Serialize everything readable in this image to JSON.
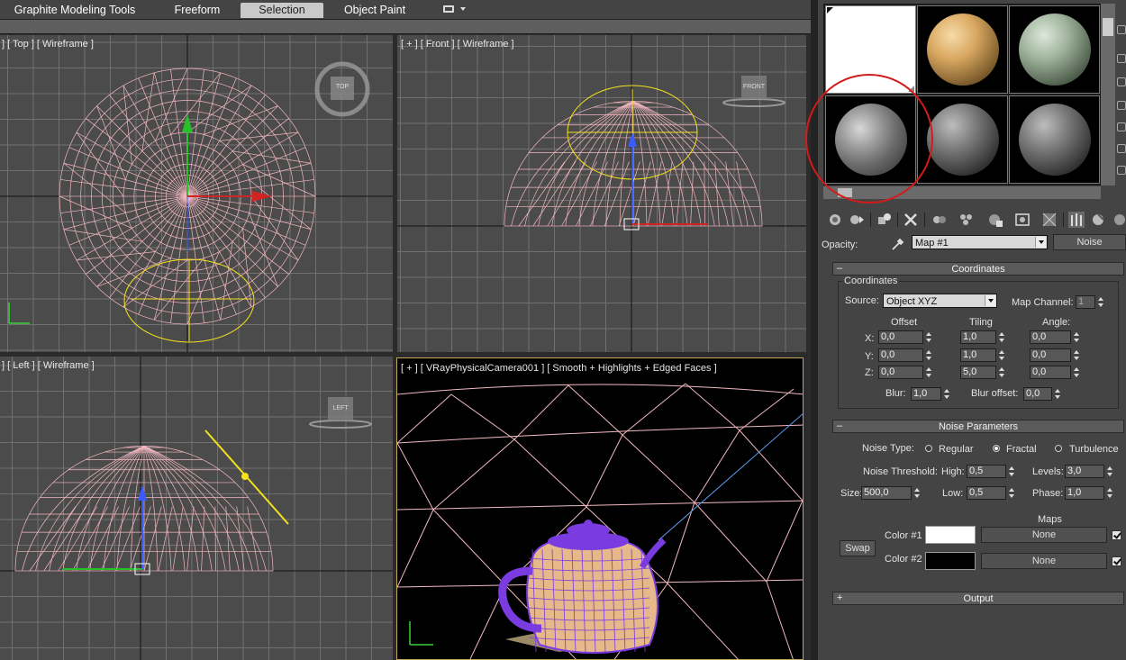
{
  "ribbon": {
    "tabs": [
      "Graphite Modeling Tools",
      "Freeform",
      "Selection",
      "Object Paint"
    ],
    "active_tab": "Selection"
  },
  "viewports": {
    "top": "] [ Top ] [ Wireframe ]",
    "front": "[ + ] [ Front ] [ Wireframe ]",
    "left": "] [ Left ] [ Wireframe ]",
    "camera": "[ + ] [ VRayPhysicalCamera001 ] [ Smooth + Highlights + Edged Faces ]",
    "viewcube_top": "TOP",
    "viewcube_front": "FRONT",
    "viewcube_left": "LEFT"
  },
  "material_editor": {
    "opacity_label": "Opacity:",
    "map_name": "Map #1",
    "map_type": "Noise",
    "coordinates": {
      "rollout_title": "Coordinates",
      "group_title": "Coordinates",
      "source_label": "Source:",
      "source_value": "Object XYZ",
      "map_channel_label": "Map Channel:",
      "map_channel_value": "1",
      "offset_label": "Offset",
      "tiling_label": "Tiling",
      "angle_label": "Angle:",
      "x_label": "X:",
      "y_label": "Y:",
      "z_label": "Z:",
      "offset": [
        "0,0",
        "0,0",
        "0,0"
      ],
      "tiling": [
        "1,0",
        "1,0",
        "5,0"
      ],
      "angle": [
        "0,0",
        "0,0",
        "0,0"
      ],
      "blur_label": "Blur:",
      "blur_value": "1,0",
      "blur_offset_label": "Blur offset:",
      "blur_offset_value": "0,0"
    },
    "noise": {
      "rollout_title": "Noise Parameters",
      "type_label": "Noise Type:",
      "types": [
        "Regular",
        "Fractal",
        "Turbulence"
      ],
      "selected_type": "Fractal",
      "threshold_label": "Noise Threshold:",
      "high_label": "High:",
      "high_value": "0,5",
      "levels_label": "Levels:",
      "levels_value": "3,0",
      "size_label": "Size:",
      "size_value": "500,0",
      "low_label": "Low:",
      "low_value": "0,5",
      "phase_label": "Phase:",
      "phase_value": "1,0",
      "maps_label": "Maps",
      "swap_label": "Swap",
      "color1_label": "Color #1",
      "color2_label": "Color #2",
      "color1": "#ffffff",
      "color2": "#000000",
      "map1": "None",
      "map2": "None"
    },
    "output": {
      "rollout_title": "Output"
    }
  },
  "colors": {
    "wireframe_pink": "#f2b8c0",
    "gizmo_yellow": "#f3e21b",
    "teapot_purple": "#7a3be0",
    "teapot_tan": "#e6b88a",
    "highlight_red": "#d41a1a"
  }
}
